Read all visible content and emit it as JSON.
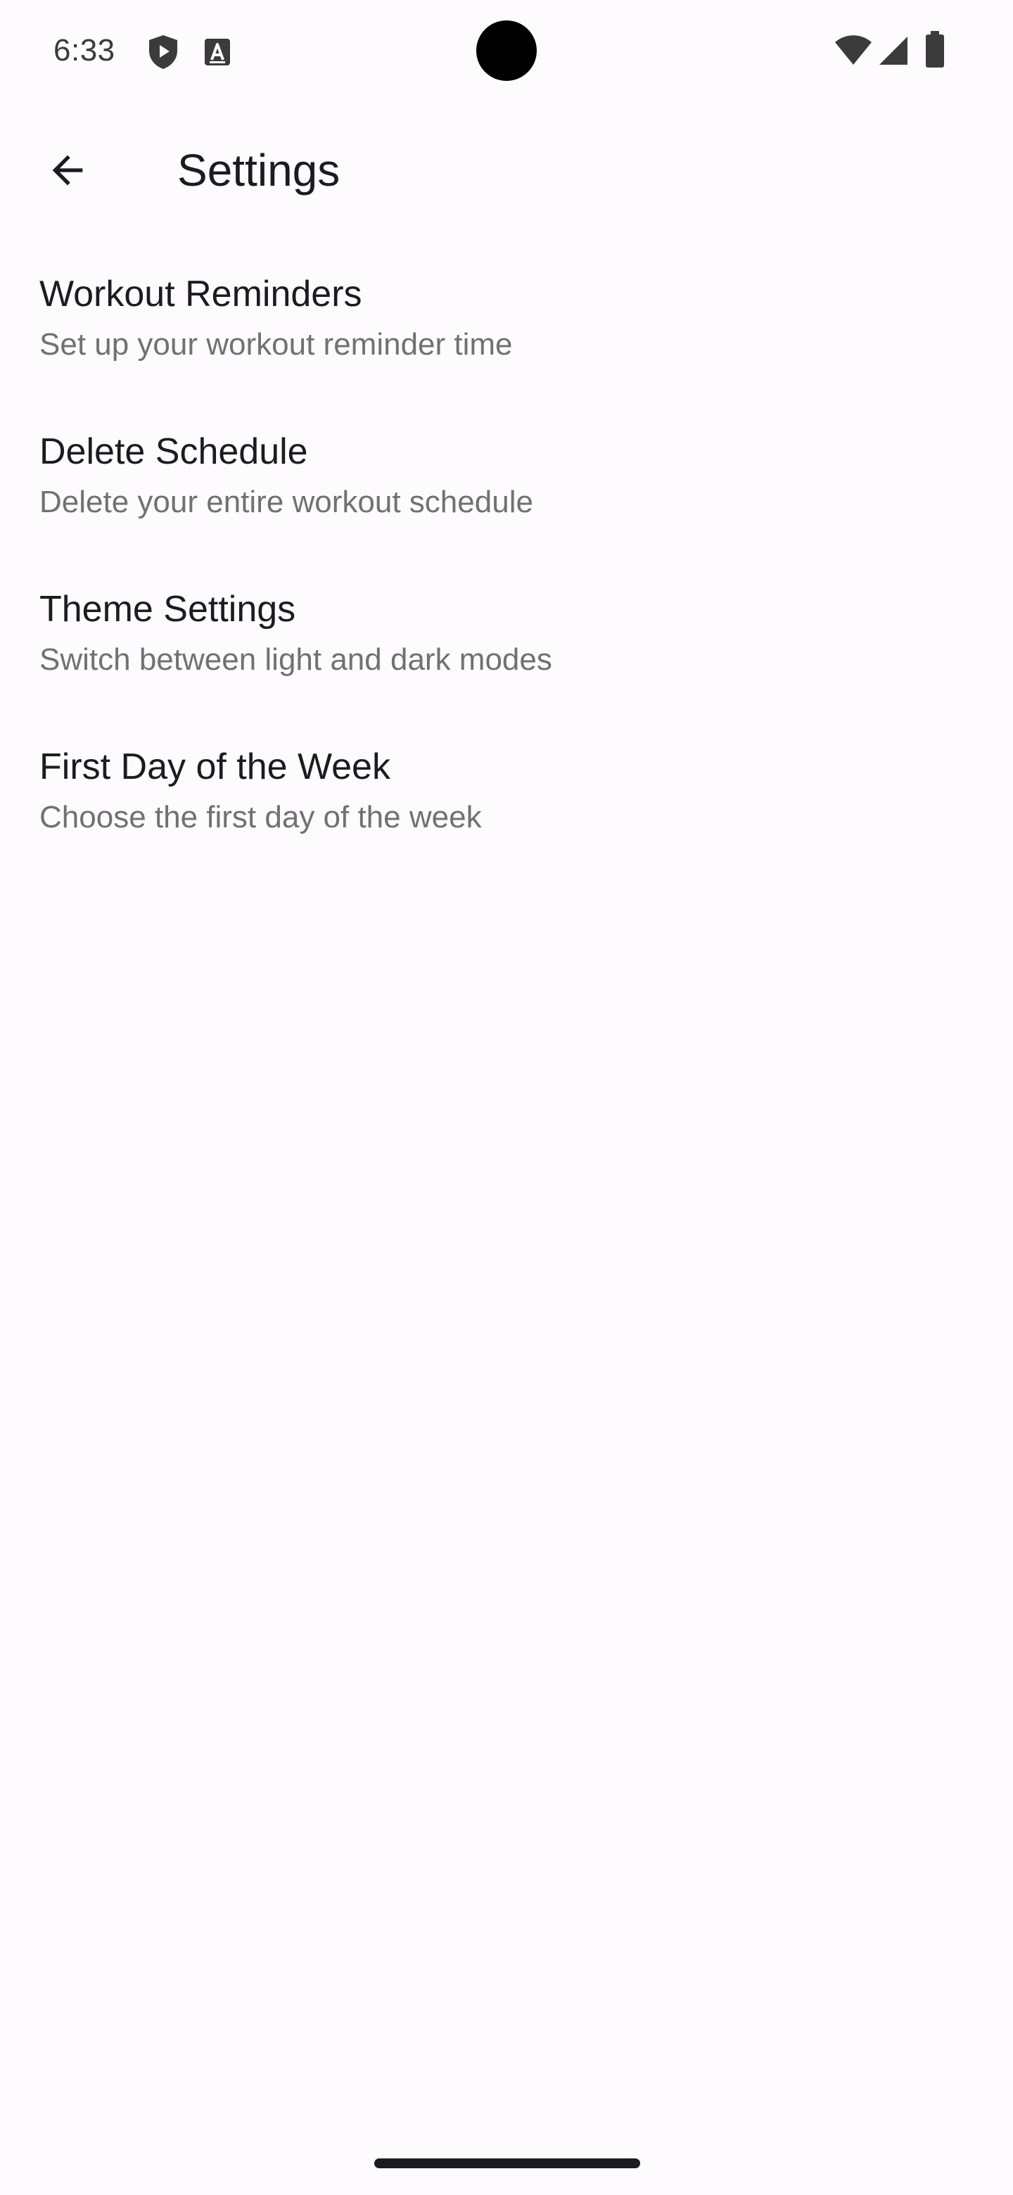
{
  "status_bar": {
    "time": "6:33",
    "left_icons": [
      "shield-play-icon",
      "text-a-icon"
    ],
    "right_icons": [
      "wifi-icon",
      "cellular-signal-icon",
      "battery-icon"
    ]
  },
  "app_bar": {
    "back_icon": "arrow-back-icon",
    "title": "Settings"
  },
  "settings": {
    "items": [
      {
        "title": "Workout Reminders",
        "subtitle": "Set up your workout reminder time"
      },
      {
        "title": "Delete Schedule",
        "subtitle": "Delete your entire workout schedule"
      },
      {
        "title": "Theme Settings",
        "subtitle": "Switch between light and dark modes"
      },
      {
        "title": "First Day of the Week",
        "subtitle": "Choose the first day of the week"
      }
    ]
  },
  "colors": {
    "background": "#fefbff",
    "title_text": "#1c1b1f",
    "subtitle_text": "#717171",
    "status_text": "#3b3b3b"
  }
}
